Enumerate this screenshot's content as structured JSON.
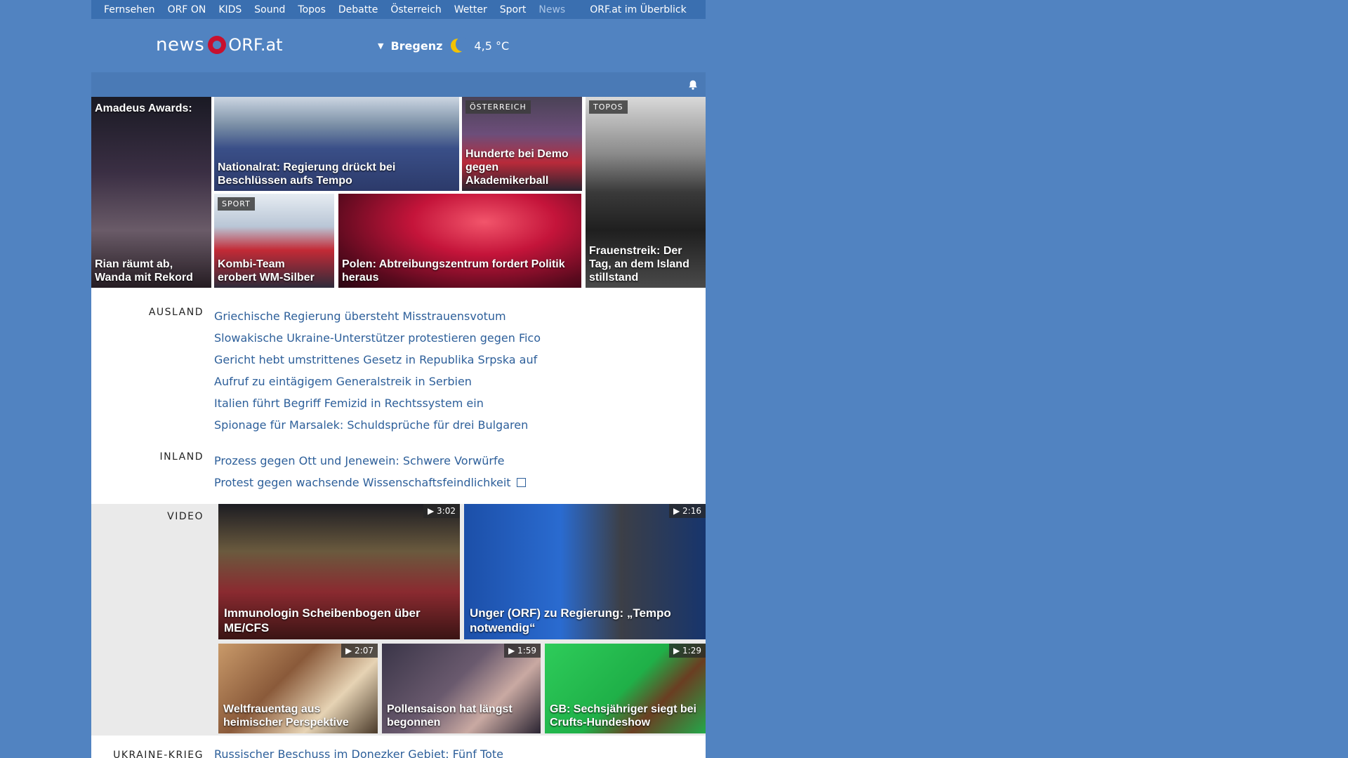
{
  "nav": {
    "items": [
      "Fernsehen",
      "ORF ON",
      "KIDS",
      "Sound",
      "Topos",
      "Debatte",
      "Österreich",
      "Wetter",
      "Sport",
      "News"
    ],
    "current": "News",
    "overview": "ORF.at im Überblick"
  },
  "logo": {
    "news": "news",
    "orf": "ORF.at"
  },
  "weather": {
    "location": "Bregenz",
    "temperature": "4,5 °C",
    "icon": "moon-icon"
  },
  "top_stories": [
    {
      "caption_top": "Amadeus Awards:",
      "caption": "Rian räumt ab, Wanda mit Rekord",
      "tag": ""
    },
    {
      "caption": "Nationalrat: Regierung drückt bei Beschlüssen aufs Tempo",
      "tag": ""
    },
    {
      "caption": "Hunderte bei Demo gegen Akademikerball",
      "tag": "ÖSTERREICH"
    },
    {
      "caption": "Frauenstreik: Der Tag, an dem Island stillstand",
      "tag": "TOPOS"
    },
    {
      "caption": "Kombi-Team erobert WM-Silber",
      "tag": "SPORT"
    },
    {
      "caption": "Polen: Abtreibungszentrum fordert Politik heraus",
      "tag": ""
    }
  ],
  "ausland": {
    "label": "AUSLAND",
    "links": [
      "Griechische Regierung übersteht Misstrauensvotum",
      "Slowakische Ukraine-Unterstützer protestieren gegen Fico",
      "Gericht hebt umstrittenes Gesetz in Republika Srpska auf",
      "Aufruf zu eintägigem Generalstreik in Serbien",
      "Italien führt Begriff Femizid in Rechtssystem ein",
      "Spionage für Marsalek: Schuldsprüche für drei Bulgaren"
    ]
  },
  "inland": {
    "label": "INLAND",
    "links": [
      "Prozess gegen Ott und Jenewein: Schwere Vorwürfe",
      "Protest gegen wachsende Wissenschaftsfeindlichkeit"
    ]
  },
  "video": {
    "label": "VIDEO",
    "items": [
      {
        "caption": "Immunologin Scheibenbogen über ME/CFS",
        "duration": "▶ 3:02"
      },
      {
        "caption": "Unger (ORF) zu Regierung: „Tempo notwendig“",
        "duration": "▶ 2:16"
      },
      {
        "caption": "Weltfrauentag aus heimischer Perspektive",
        "duration": "▶ 2:07"
      },
      {
        "caption": "Pollensaison hat längst begonnen",
        "duration": "▶ 1:59"
      },
      {
        "caption": "GB: Sechsjähriger siegt bei Crufts-Hundeshow",
        "duration": "▶ 1:29"
      }
    ]
  },
  "ukraine": {
    "label": "UKRAINE-KRIEG",
    "link": "Russischer Beschuss im Donezker Gebiet: Fünf Tote"
  }
}
